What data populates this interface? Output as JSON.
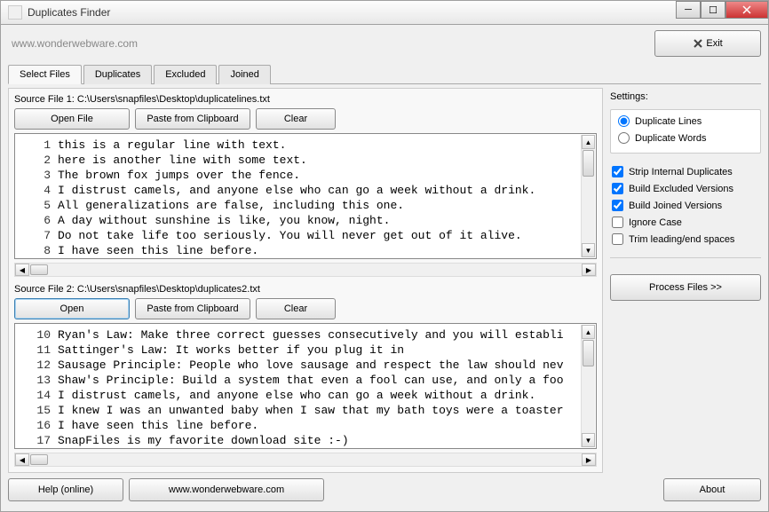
{
  "window": {
    "title": "Duplicates Finder"
  },
  "topbar": {
    "url": "www.wonderwebware.com",
    "exit": "Exit"
  },
  "tabs": [
    "Select Files",
    "Duplicates",
    "Excluded",
    "Joined"
  ],
  "source1": {
    "label": "Source File 1: C:\\Users\\snapfiles\\Desktop\\duplicatelines.txt",
    "open": "Open File",
    "paste": "Paste from Clipboard",
    "clear": "Clear",
    "lines": [
      {
        "n": 1,
        "t": "this is a regular line with text."
      },
      {
        "n": 2,
        "t": "here is another line with some text."
      },
      {
        "n": 3,
        "t": "The brown fox jumps over the fence."
      },
      {
        "n": 4,
        "t": "I distrust camels, and anyone else who can go a week without a drink."
      },
      {
        "n": 5,
        "t": "All generalizations are false, including this one."
      },
      {
        "n": 6,
        "t": "A day without sunshine is like, you know, night."
      },
      {
        "n": 7,
        "t": "Do not take life too seriously. You will never get out of it alive."
      },
      {
        "n": 8,
        "t": "I have seen this line before."
      }
    ]
  },
  "source2": {
    "label": "Source File 2: C:\\Users\\snapfiles\\Desktop\\duplicates2.txt",
    "open": "Open",
    "paste": "Paste from Clipboard",
    "clear": "Clear",
    "lines": [
      {
        "n": 10,
        "t": "Ryan's Law: Make three correct guesses consecutively and you will establi"
      },
      {
        "n": 11,
        "t": "Sattinger's Law: It works better if you plug it in"
      },
      {
        "n": 12,
        "t": "Sausage Principle: People who love sausage and respect the law should nev"
      },
      {
        "n": 13,
        "t": "Shaw's Principle: Build a system that even a fool can use, and only a foo"
      },
      {
        "n": 14,
        "t": "I distrust camels, and anyone else who can go a week without a drink."
      },
      {
        "n": 15,
        "t": "I knew I was an unwanted baby when I saw that my bath toys were a toaster"
      },
      {
        "n": 16,
        "t": "I have seen this line before."
      },
      {
        "n": 17,
        "t": "SnapFiles is my favorite download site :-)"
      }
    ]
  },
  "settings": {
    "label": "Settings:",
    "mode": {
      "lines": "Duplicate Lines",
      "words": "Duplicate Words",
      "selected": "lines"
    },
    "checks": {
      "strip": {
        "label": "Strip Internal Duplicates",
        "checked": true
      },
      "excluded": {
        "label": "Build Excluded Versions",
        "checked": true
      },
      "joined": {
        "label": "Build Joined Versions",
        "checked": true
      },
      "ignorecase": {
        "label": "Ignore Case",
        "checked": false
      },
      "trim": {
        "label": "Trim leading/end spaces",
        "checked": false
      }
    },
    "process": "Process Files  >>"
  },
  "bottom": {
    "help": "Help (online)",
    "site": "www.wonderwebware.com",
    "about": "About"
  }
}
